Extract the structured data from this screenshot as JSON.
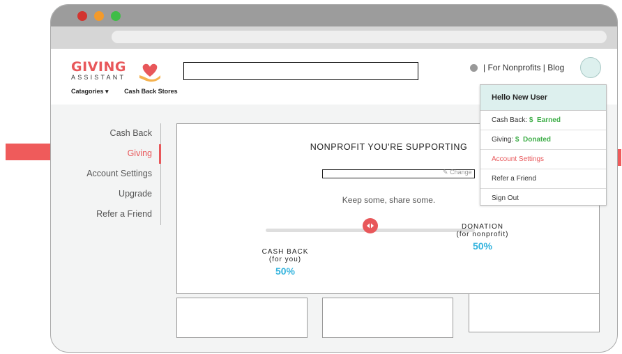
{
  "header": {
    "logo_main": "GIVING",
    "logo_sub": "ASSISTANT",
    "nav_categories": "Catagories ▾",
    "nav_cashback_stores": "Cash Back Stores",
    "top_links": "| For Nonprofits | Blog"
  },
  "sidebar": {
    "items": [
      {
        "label": "Cash Back"
      },
      {
        "label": "Giving"
      },
      {
        "label": "Account Settings"
      },
      {
        "label": "Upgrade"
      },
      {
        "label": "Refer a Friend"
      }
    ]
  },
  "main": {
    "title": "NONPROFIT YOU'RE SUPPORTING",
    "change_label": "Change",
    "tagline": "Keep some, share some.",
    "cashback_label": "CASH BACK",
    "cashback_sub": "(for you)",
    "cashback_pct": "50%",
    "donation_label": "DONATION",
    "donation_sub": "(for nonprofit)",
    "donation_pct": "50%",
    "slider_fraction": 0.5
  },
  "dropdown": {
    "greeting": "Hello New User",
    "cashback_prefix": "Cash Back: ",
    "cashback_dollar": "$",
    "cashback_status": "Earned",
    "giving_prefix": "Giving: ",
    "giving_dollar": "$",
    "giving_status": "Donated",
    "account_settings": "Account Settings",
    "refer": "Refer a Friend",
    "signout": "Sign Out"
  },
  "colors": {
    "brand": "#e8575a",
    "accent_blue": "#35b4de",
    "green": "#3fae49",
    "dropdown_header": "#ddf0ee",
    "arrow": "#ef5b5b"
  }
}
